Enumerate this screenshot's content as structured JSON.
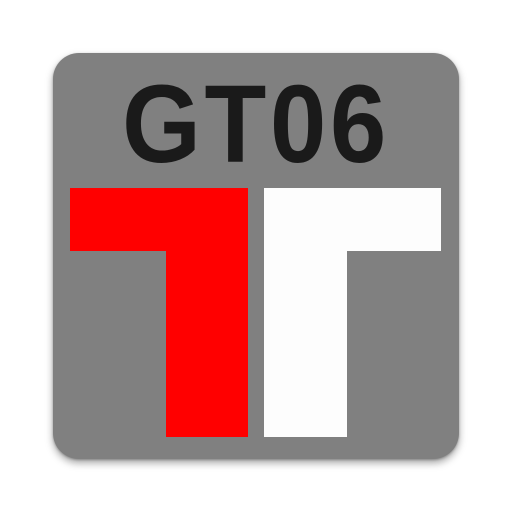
{
  "icon": {
    "title": "GT06",
    "colors": {
      "background": "#808080",
      "title_text": "#1a1a1a",
      "left_shape": "#ff0000",
      "right_shape": "#fdfdfd"
    }
  }
}
